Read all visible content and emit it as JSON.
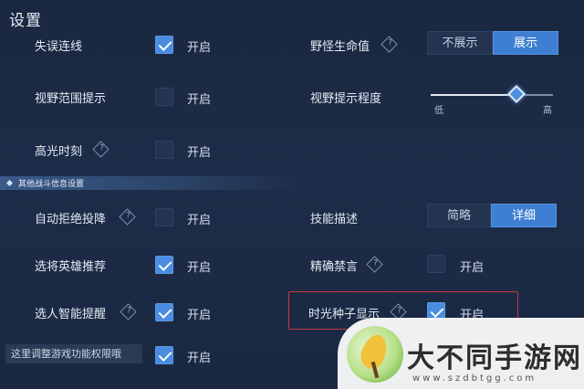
{
  "header": {
    "title": "设置"
  },
  "top_row": {
    "left_label": "失误连线",
    "left_checked": true,
    "left_state": "开启",
    "right_label": "野怪生命值",
    "segment": {
      "options": [
        "不展示",
        "展示"
      ],
      "selected": 1
    }
  },
  "vision_range": {
    "label": "视野范围提示",
    "checked": false,
    "state": "开启"
  },
  "vision_level": {
    "label": "视野提示程度",
    "min_label": "低",
    "max_label": "高",
    "value_fraction": 0.7
  },
  "highlight": {
    "label": "高光时刻",
    "checked": false,
    "state": "开启"
  },
  "section": {
    "title": "其他战斗信息设置"
  },
  "auto_reject": {
    "label": "自动拒绝投降",
    "checked": false,
    "state": "开启"
  },
  "skill_desc": {
    "label": "技能描述",
    "options": [
      "简略",
      "详细"
    ],
    "selected": 1
  },
  "hero_recommend": {
    "label": "选将英雄推荐",
    "checked": true,
    "state": "开启"
  },
  "precise_mute": {
    "label": "精确禁言",
    "checked": false,
    "state": "开启"
  },
  "smart_reminder": {
    "label": "选人智能提醒",
    "checked": true,
    "state": "开启"
  },
  "time_seed": {
    "label": "时光种子显示",
    "checked": true,
    "state": "开启"
  },
  "tooltip_row": {
    "tooltip": "这里调整游戏功能权限哦",
    "checked": true,
    "state": "开启"
  },
  "watermark": {
    "brand": "大不同手游网",
    "url": "www.szdbtgg.com"
  },
  "colors": {
    "accent": "#4a8cdf",
    "highlight_box": "#c4393d",
    "background": "#1d2c48"
  }
}
